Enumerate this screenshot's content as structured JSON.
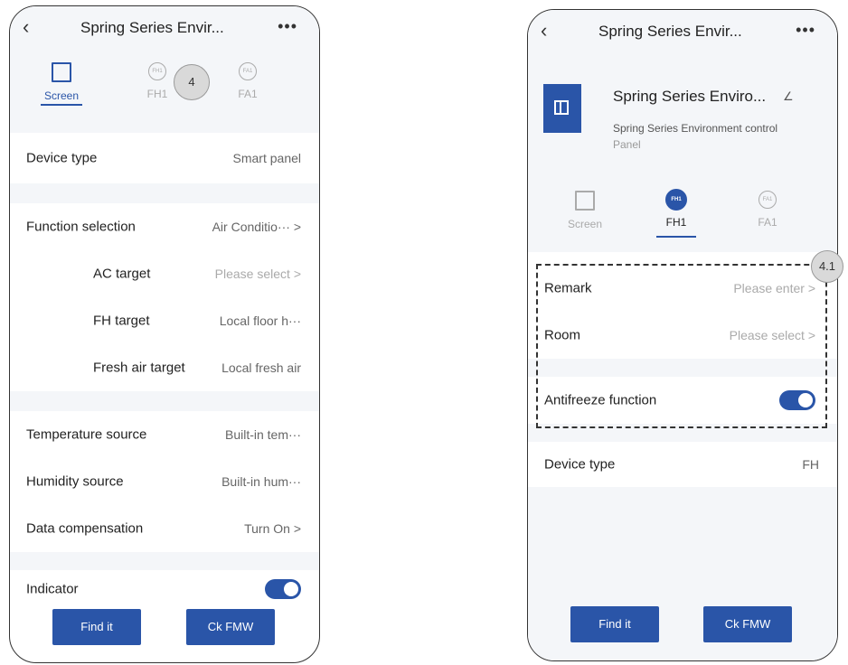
{
  "screen1": {
    "header": {
      "back_icon": "chevron-left-icon",
      "title": "Spring Series Envir...",
      "more_icon": "more-icon",
      "more": "•••"
    },
    "tabs": [
      {
        "label": "Screen",
        "icon": "screen-icon",
        "badge": ""
      },
      {
        "label": "FH1",
        "icon": "circle-icon",
        "badge": "FH1"
      },
      {
        "label": "FA1",
        "icon": "circle-icon",
        "badge": "FA1"
      }
    ],
    "marker": "4",
    "rows": {
      "device_type": {
        "label": "Device type",
        "value": "Smart panel"
      },
      "function_selection": {
        "label": "Function selection",
        "value": "Air Conditio··· >"
      },
      "ac_target": {
        "label": "AC target",
        "value": "Please select >"
      },
      "fh_target": {
        "label": "FH target",
        "value": "Local floor h···"
      },
      "fresh_air_target": {
        "label": "Fresh air target",
        "value": "Local fresh air"
      },
      "temperature_source": {
        "label": "Temperature source",
        "value": "Built-in tem···"
      },
      "humidity_source": {
        "label": "Humidity source",
        "value": "Built-in hum···"
      },
      "data_compensation": {
        "label": "Data compensation",
        "value": "Turn On >"
      },
      "indicator": {
        "label": "Indicator",
        "on": true
      }
    },
    "buttons": {
      "find": "Find it",
      "ckfmw": "Ck FMW"
    }
  },
  "screen2": {
    "header": {
      "back_icon": "chevron-left-icon",
      "title": "Spring Series Envir...",
      "more_icon": "more-icon",
      "more": "•••"
    },
    "device": {
      "name": "Spring Series Enviro...",
      "desc_line1": "Spring Series Environment control",
      "desc_line2": "Panel",
      "edit_icon": "pencil-icon",
      "icon": "panel-icon"
    },
    "tabs": [
      {
        "label": "Screen",
        "icon": "screen-icon",
        "badge": ""
      },
      {
        "label": "FH1",
        "icon": "circle-icon",
        "badge": "FH1"
      },
      {
        "label": "FA1",
        "icon": "circle-icon",
        "badge": "FA1"
      }
    ],
    "marker": "4.1",
    "rows": {
      "remark": {
        "label": "Remark",
        "value": "Please enter >"
      },
      "room": {
        "label": "Room",
        "value": "Please select >"
      },
      "antifreeze": {
        "label": "Antifreeze function",
        "on": true
      },
      "device_type": {
        "label": "Device type",
        "value": "FH"
      }
    },
    "buttons": {
      "find": "Find it",
      "ckfmw": "Ck FMW"
    }
  },
  "colors": {
    "accent": "#2a55a8",
    "section_bg": "#f4f6f9"
  }
}
